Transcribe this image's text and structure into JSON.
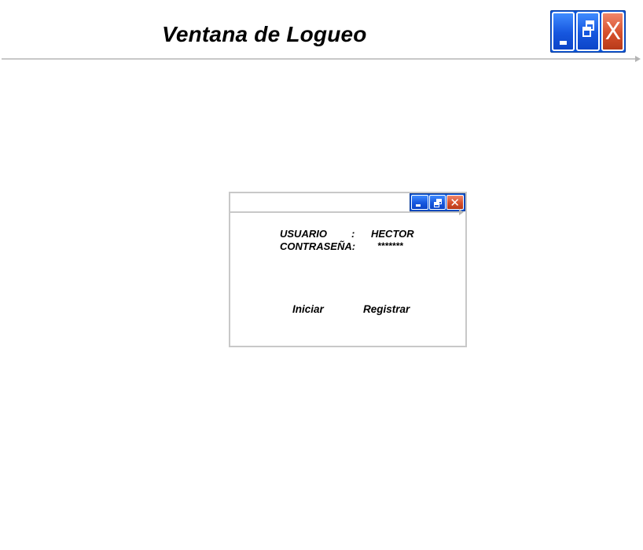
{
  "header": {
    "title": "Ventana de Logueo",
    "window_controls": {
      "minimize_icon": "minimize-icon",
      "restore_icon": "restore-icon",
      "close_icon": "close-icon",
      "close_glyph": "X"
    }
  },
  "login_window": {
    "window_controls": {
      "minimize_icon": "minimize-icon",
      "restore_icon": "restore-icon",
      "close_icon": "close-icon",
      "close_glyph": "✕"
    },
    "user_label": "USUARIO",
    "user_separator": ":",
    "user_value": "HECTOR",
    "password_label": "CONTRASEÑA:",
    "password_value": "*******",
    "start_button": "Iniciar",
    "register_button": "Registrar"
  },
  "colors": {
    "control_blue": "#1656de",
    "control_close": "#d6502c",
    "rule_gray": "#c8c8c8"
  }
}
